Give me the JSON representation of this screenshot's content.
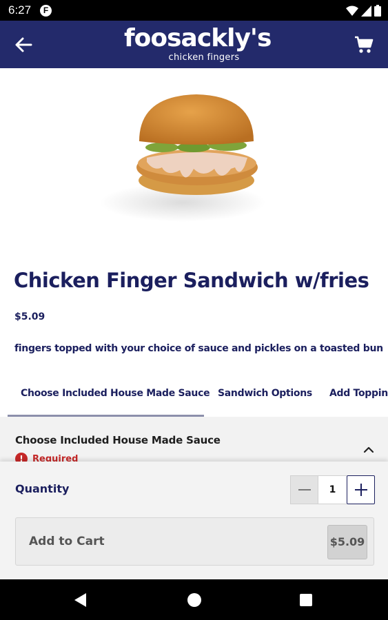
{
  "status_bar": {
    "time": "6:27",
    "notification_badge": "F",
    "icons": [
      "wifi-icon",
      "signal-icon",
      "battery-icon"
    ]
  },
  "app_bar": {
    "logo_main": "foosackly's",
    "logo_sub": "chicken fingers",
    "back_icon": "arrow-left-icon",
    "cart_icon": "shopping-cart-icon",
    "background": "#232a6b"
  },
  "product": {
    "image": "chicken-sandwich-photo",
    "title": "Chicken Finger Sandwich w/fries",
    "price": "$5.09",
    "description": "fingers topped with your choice of sauce and pickles on a toasted bun"
  },
  "tabs": [
    {
      "label": "Choose Included House Made Sauce",
      "active": true
    },
    {
      "label": "Sandwich Options",
      "active": false
    },
    {
      "label": "Add Toppin",
      "active": false
    }
  ],
  "section": {
    "title": "Choose Included House Made Sauce",
    "required_label": "Required",
    "required_icon": "!",
    "expanded": true
  },
  "quantity": {
    "label": "Quantity",
    "value": "1"
  },
  "add_to_cart": {
    "label": "Add to Cart",
    "price": "$5.09"
  },
  "colors": {
    "navy": "#1b1f5e",
    "error": "#c62828"
  }
}
